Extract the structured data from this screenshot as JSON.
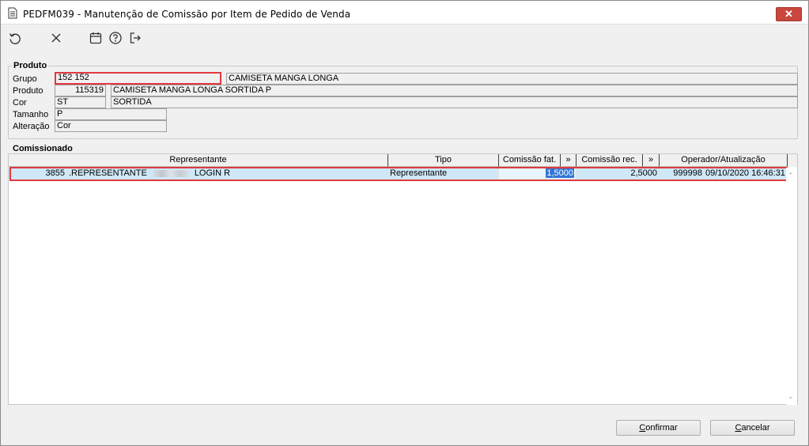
{
  "window": {
    "title": "PEDFM039 - Manutenção de Comissão por Item de Pedido de Venda",
    "close_glyph": "✕"
  },
  "toolbar": {
    "icons": [
      "refresh-icon",
      "close-icon",
      "calendar-icon",
      "help-icon",
      "exit-icon"
    ]
  },
  "produto": {
    "section_label": "Produto",
    "grupo_label": "Grupo",
    "grupo_code": "152 152",
    "grupo_desc": "CAMISETA MANGA LONGA",
    "produto_label": "Produto",
    "produto_code": "115319",
    "produto_desc": "CAMISETA MANGA LONGA SORTIDA P",
    "cor_label": "Cor",
    "cor_code": "ST",
    "cor_desc": "SORTIDA",
    "tamanho_label": "Tamanho",
    "tamanho_value": "P",
    "alteracao_label": "Alteração",
    "alteracao_value": "Cor"
  },
  "comissionado": {
    "section_label": "Comissionado",
    "columns": {
      "representante": "Representante",
      "tipo": "Tipo",
      "comissao_fat": "Comissão fat.",
      "fat_more": "»",
      "comissao_rec": "Comissão rec.",
      "rec_more": "»",
      "operador": "Operador/Atualização"
    },
    "rows": [
      {
        "codigo": "3855",
        "representante_prefix": ".REPRESENTANTE",
        "representante_suffix": "LOGIN R",
        "tipo": "Representante",
        "comissao_fat": "1,5000",
        "comissao_rec": "2,5000",
        "operador": "999998",
        "atualizacao": "09/10/2020 16:46:31"
      }
    ]
  },
  "buttons": {
    "confirmar": {
      "first": "C",
      "rest": "onfirmar"
    },
    "cancelar": {
      "first": "C",
      "rest": "ancelar"
    }
  },
  "colors": {
    "highlight_border": "#e0393e",
    "selected_row": "#cfe8f7",
    "selected_cell": "#3377d6"
  }
}
